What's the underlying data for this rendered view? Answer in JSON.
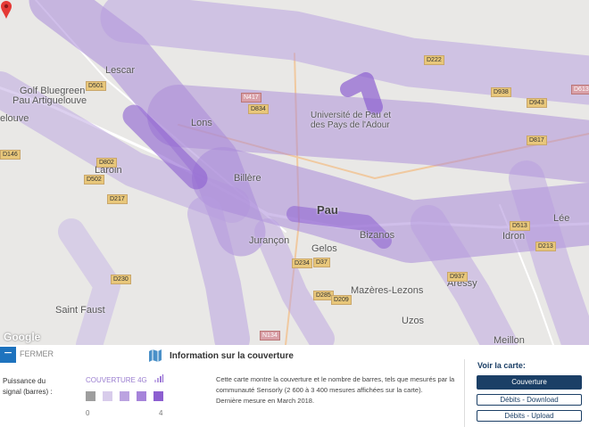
{
  "map": {
    "places": {
      "lescar": "Lescar",
      "golf1": "Golf Bluegreen",
      "golf2": "Pau Artiguelouve",
      "artiguelouve": "elouve",
      "lons": "Lons",
      "laroin": "Laroin",
      "billere": "Billère",
      "pau": "Pau",
      "jurancon": "Jurançon",
      "gelos": "Gelos",
      "bizanos": "Bizanos",
      "idron": "Idron",
      "lee": "Lée",
      "aressy": "Aressy",
      "mazeres": "Mazères-Lezons",
      "uzos": "Uzos",
      "meillon": "Meillon",
      "saintfaust": "Saint Faust",
      "univ1": "Université de Pau et",
      "univ2": "des Pays de l'Adour"
    },
    "roads": [
      "D501",
      "D802",
      "D502",
      "D217",
      "N417",
      "D834",
      "D222",
      "D938",
      "D943",
      "D817",
      "D213",
      "D513",
      "D37",
      "D234",
      "D285",
      "D209",
      "D937",
      "N134",
      "D230",
      "D146",
      "D613"
    ],
    "attribution": "Google"
  },
  "panel": {
    "close_label": "FERMER",
    "legend_label": "Puissance du signal (barres) :",
    "coverage_title": "COUVERTURE 4G",
    "scale_min": "0",
    "scale_max": "4",
    "swatch_colors": [
      "#9e9e9e",
      "#d8cceb",
      "#bba3e0",
      "#a684da",
      "#8c5fd0"
    ],
    "info_title": "Information sur la couverture",
    "info_text": "Cette carte montre la couverture et le nombre de barres, tels que mesurés par la communauté Sensorly (2 600 à 3 400 mesures affichées sur la carte).",
    "info_date": "Dernière mesure en March 2018.",
    "voir_label": "Voir la carte:",
    "buttons": [
      "Couverture",
      "Débits - Download",
      "Débits - Upload"
    ]
  }
}
